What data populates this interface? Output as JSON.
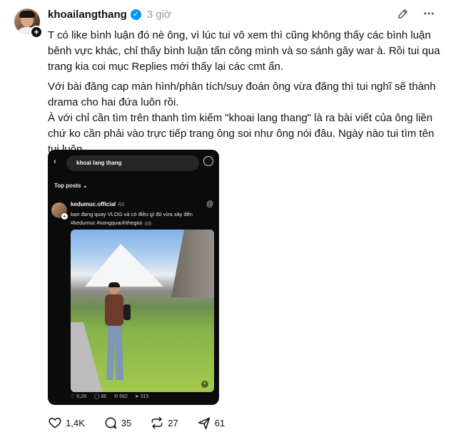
{
  "post": {
    "username": "khoailangthang",
    "time": "3 giờ",
    "paragraphs": [
      "T có like bình luận đó nè ông, vì lúc tui vô xem thì cũng không thấy các bình luận bênh vực khác, chỉ thấy bình luận tấn công mình và so sánh gây war à. Rồi tui qua trang kia coi mục Replies mới thấy lại các cmt ẩn.",
      "Với bài đăng cap màn hình/phân tích/suy đoán ông vừa đăng thì tui nghĩ sẽ thành drama cho hai đứa luôn rồi.",
      "À với chỉ cần tìm trên thanh tìm kiếm \"khoai lang thang\" là ra bài viết của ông liền chứ ko cần phải vào trực tiếp trang ông soi như ông nói đâu. Ngày nào tui tìm tên tui luôn"
    ]
  },
  "screenshot": {
    "search_text": "khoai lang thang",
    "section_label": "Top posts",
    "username": "kedumuc.official",
    "ago": "4d",
    "caption_line1": "bạn đang quay VLOG và có điều gì đó vừa xảy đến",
    "caption_line2": "#kedumuc #vongquanhthegioi",
    "pager": "1/3",
    "likes": "8,2K",
    "comments": "86",
    "reposts": "562",
    "shares": "315"
  },
  "actions": {
    "likes": "1,4K",
    "comments": "35",
    "reposts": "27",
    "shares": "61"
  },
  "colors": {
    "verified": "#0095f6",
    "text": "#101010",
    "muted": "#999999"
  },
  "icons": [
    "edit-icon",
    "more-icon",
    "verified-icon",
    "heart-icon",
    "comment-icon",
    "repost-icon",
    "share-icon"
  ]
}
